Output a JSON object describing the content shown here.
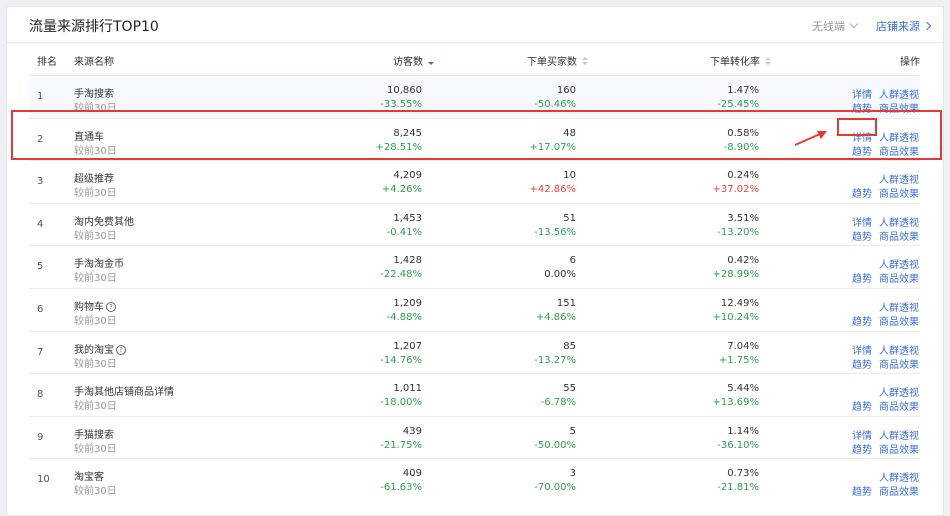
{
  "header": {
    "title": "流量来源排行TOP10",
    "platform_select": "无线端",
    "store_link": "店铺来源"
  },
  "columns": {
    "rank": "排名",
    "name": "来源名称",
    "visitors": "访客数",
    "buyers": "下单买家数",
    "conversion": "下单转化率",
    "actions": "操作"
  },
  "actions": {
    "detail": "详情",
    "crowd": "人群透视",
    "trend": "趋势",
    "goods": "商品效果"
  },
  "rows": [
    {
      "rank": "1",
      "name": "手淘搜索",
      "sub": "较前30日",
      "visitors": "10,860",
      "visitors_change": "-33.55%",
      "buyers": "160",
      "buyers_change": "-50.46%",
      "conversion": "1.47%",
      "conversion_change": "-25.45%"
    },
    {
      "rank": "2",
      "name": "直通车",
      "sub": "较前30日",
      "visitors": "8,245",
      "visitors_change": "+28.51%",
      "buyers": "48",
      "buyers_change": "+17.07%",
      "conversion": "0.58%",
      "conversion_change": "-8.90%"
    },
    {
      "rank": "3",
      "name": "超级推荐",
      "sub": "较前30日",
      "visitors": "4,209",
      "visitors_change": "+4.26%",
      "buyers": "10",
      "buyers_change": "+42.86%",
      "conversion": "0.24%",
      "conversion_change": "+37.02%"
    },
    {
      "rank": "4",
      "name": "淘内免费其他",
      "sub": "较前30日",
      "visitors": "1,453",
      "visitors_change": "-0.41%",
      "buyers": "51",
      "buyers_change": "-13.56%",
      "conversion": "3.51%",
      "conversion_change": "-13.20%"
    },
    {
      "rank": "5",
      "name": "手淘淘金币",
      "sub": "较前30日",
      "visitors": "1,428",
      "visitors_change": "-22.48%",
      "buyers": "6",
      "buyers_change": "0.00%",
      "conversion": "0.42%",
      "conversion_change": "+28.99%"
    },
    {
      "rank": "6",
      "name": "购物车",
      "sub": "较前30日",
      "visitors": "1,209",
      "visitors_change": "-4.88%",
      "buyers": "151",
      "buyers_change": "+4.86%",
      "conversion": "12.49%",
      "conversion_change": "+10.24%"
    },
    {
      "rank": "7",
      "name": "我的淘宝",
      "sub": "较前30日",
      "visitors": "1,207",
      "visitors_change": "-14.76%",
      "buyers": "85",
      "buyers_change": "-13.27%",
      "conversion": "7.04%",
      "conversion_change": "+1.75%"
    },
    {
      "rank": "8",
      "name": "手淘其他店铺商品详情",
      "sub": "较前30日",
      "visitors": "1,011",
      "visitors_change": "-18.00%",
      "buyers": "55",
      "buyers_change": "-6.78%",
      "conversion": "5.44%",
      "conversion_change": "+13.69%"
    },
    {
      "rank": "9",
      "name": "手猫搜索",
      "sub": "较前30日",
      "visitors": "439",
      "visitors_change": "-21.75%",
      "buyers": "5",
      "buyers_change": "-50.00%",
      "conversion": "1.14%",
      "conversion_change": "-36.10%"
    },
    {
      "rank": "10",
      "name": "淘宝客",
      "sub": "较前30日",
      "visitors": "409",
      "visitors_change": "-61.63%",
      "buyers": "3",
      "buyers_change": "-70.00%",
      "conversion": "0.73%",
      "conversion_change": "-21.81%"
    }
  ],
  "help_icon": "?",
  "colors": {
    "accent": "#3a6fd8",
    "up": "#e54545",
    "down": "#2f9e4f",
    "highlight": "#e53935"
  }
}
